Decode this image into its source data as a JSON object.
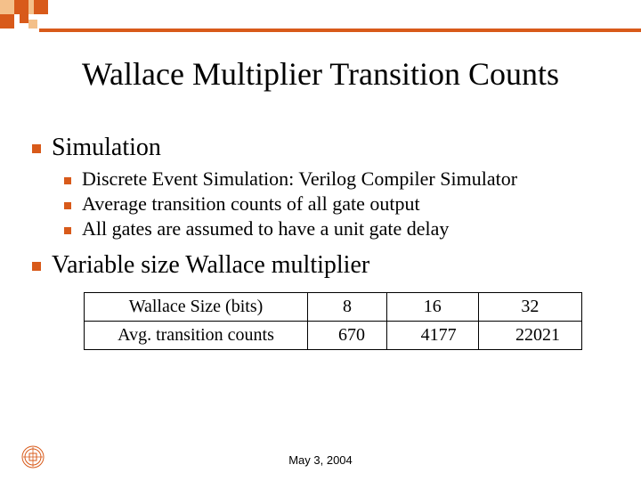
{
  "title": "Wallace Multiplier Transition Counts",
  "bullets_l1": {
    "b0": "Simulation",
    "b1": "Variable size Wallace multiplier"
  },
  "bullets_sim": {
    "s0": "Discrete Event Simulation: Verilog Compiler Simulator",
    "s1": "Average transition counts of all gate output",
    "s2": "All gates are assumed to have a unit gate delay"
  },
  "table": {
    "header": {
      "c0": "Wallace Size (bits)",
      "c1": "8",
      "c2": "16",
      "c3": "32"
    },
    "row": {
      "c0": "Avg. transition counts",
      "c1": "670",
      "c2": "4177",
      "c3": "22021"
    }
  },
  "footer_date": "May 3, 2004",
  "accent": "#D85A1A"
}
